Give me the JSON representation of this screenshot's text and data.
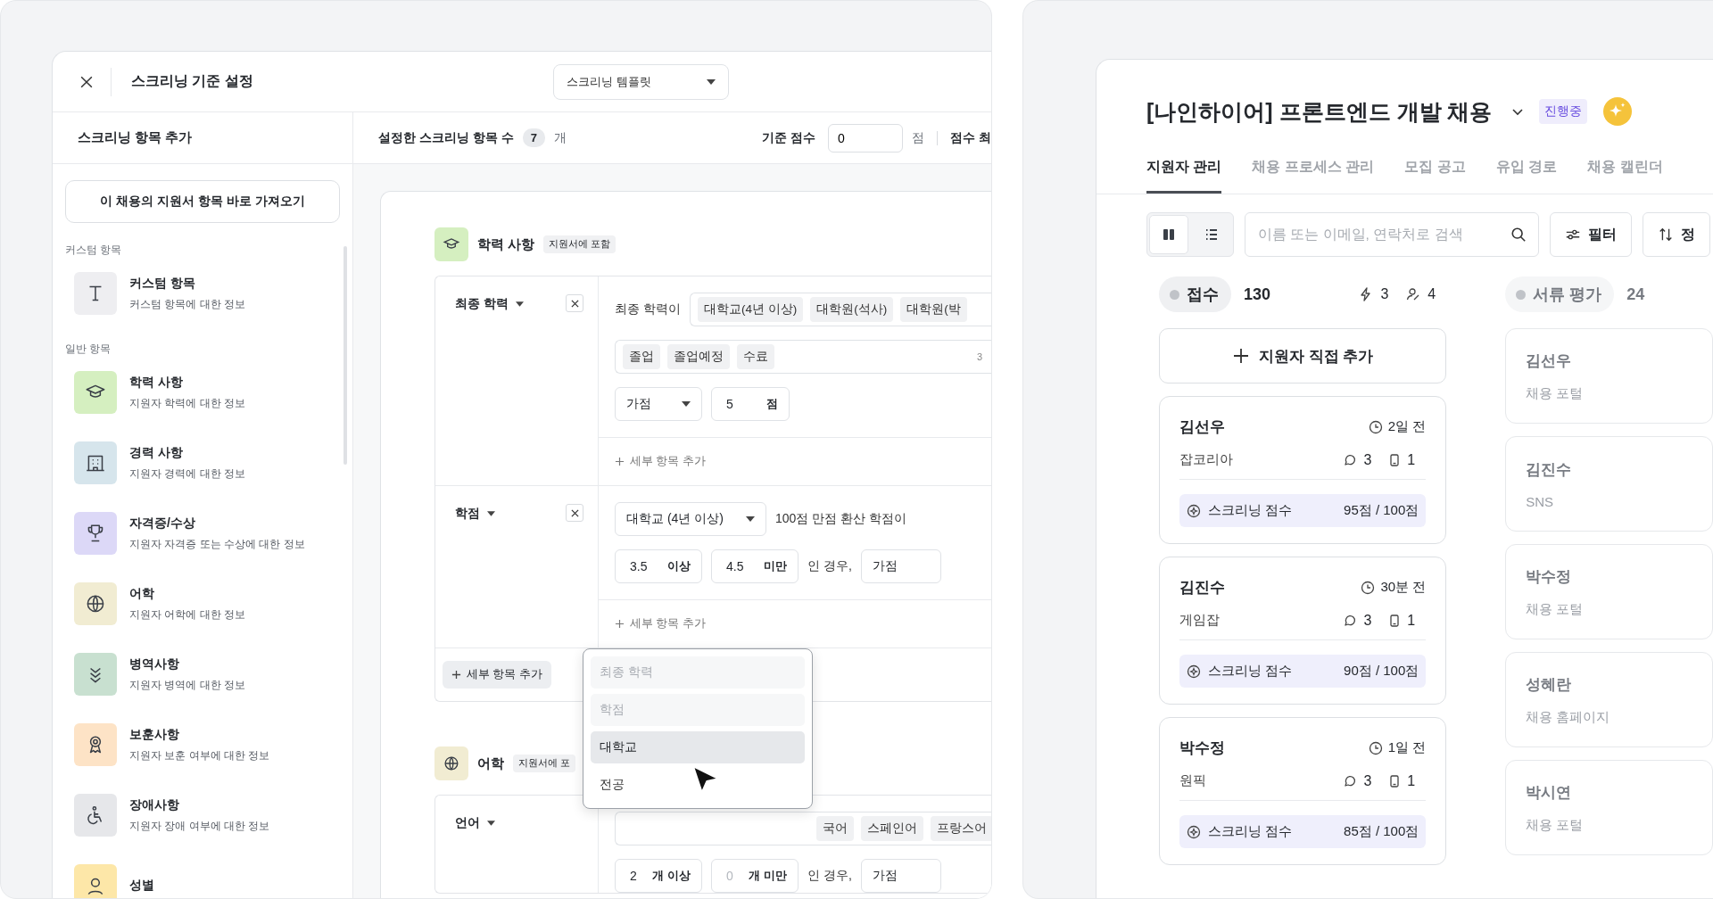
{
  "screening_window": {
    "title": "스크리닝 기준 설정",
    "template_select": {
      "value": "스크리닝 템플릿"
    },
    "sidebar": {
      "heading": "스크리닝 항목 추가",
      "import_button": "이 채용의 지원서 항목 바로 가져오기",
      "groups": [
        {
          "label": "커스텀 항목",
          "items": [
            {
              "title": "커스텀 항목",
              "description": "커스텀 항목에 대한 정보",
              "color": "#eeeef1"
            }
          ]
        },
        {
          "label": "일반 항목",
          "items": [
            {
              "title": "학력 사항",
              "description": "지원자 학력에 대한 정보",
              "color": "#d5efc0"
            },
            {
              "title": "경력 사항",
              "description": "지원자 경력에 대한 정보",
              "color": "#d6e5ec"
            },
            {
              "title": "자격증/수상",
              "description": "지원자 자격증 또는 수상에 대한 정보",
              "color": "#dcd8f7"
            },
            {
              "title": "어학",
              "description": "지원자 어학에 대한 정보",
              "color": "#f1ecd2"
            },
            {
              "title": "병역사항",
              "description": "지원자 병역에 대한 정보",
              "color": "#c8e0d0"
            },
            {
              "title": "보훈사항",
              "description": "지원자 보훈 여부에 대한 정보",
              "color": "#fde3c6"
            },
            {
              "title": "장애사항",
              "description": "지원자 장애 여부에 대한 정보",
              "color": "#e6e7ea"
            },
            {
              "title": "성별",
              "color": "#fde7a8"
            }
          ]
        }
      ]
    },
    "summary": {
      "label": "설정한 스크리닝 항목 수",
      "count": "7",
      "unit": "개",
      "base_score_label": "기준 점수",
      "base_score_value": "0",
      "base_score_unit": "점",
      "next_label": "점수 최"
    },
    "education": {
      "title": "학력 사항",
      "badge": "지원서에 포함",
      "color": "#d5efc0",
      "final_degree": {
        "label": "최종 학력",
        "prefix": "최종 학력이",
        "degrees": [
          "대학교(4년 이상)",
          "대학원(석사)",
          "대학원(박"
        ],
        "statuses": [
          "졸업",
          "졸업예정",
          "수료"
        ],
        "status_count": "3",
        "score_type": "가점",
        "score": "5",
        "score_unit": "점",
        "add_sub": "세부 항목 추가"
      },
      "gpa": {
        "label": "학점",
        "school": "대학교 (4년 이상)",
        "suffix": "100점 만점 환산 학점이",
        "min": "3.5",
        "min_unit": "이상",
        "max": "4.5",
        "max_unit": "미만",
        "condition": "인 경우,",
        "score_type": "가점",
        "add_sub": "세부 항목 추가"
      },
      "add_button": "세부 항목 추가",
      "menu": [
        {
          "label": "최종 학력",
          "disabled": true,
          "selected": false
        },
        {
          "label": "학점",
          "disabled": true,
          "selected": false
        },
        {
          "label": "대학교",
          "disabled": false,
          "selected": true
        },
        {
          "label": "전공",
          "disabled": false,
          "selected": false
        }
      ]
    },
    "language": {
      "title": "어학",
      "badge": "지원서에 포",
      "color": "#f1ecd2",
      "criterion": {
        "label": "언어",
        "languages": [
          "국어",
          "스페인어",
          "프랑스어"
        ],
        "min": "2",
        "min_unit": "개 이상",
        "max_placeholder": "0",
        "max_unit": "개 미만",
        "condition": "인 경우,",
        "score_type": "가점"
      }
    }
  },
  "hiring_window": {
    "title": "[나인하이어] 프론트엔드 개발 채용",
    "status": "진행중",
    "tabs": [
      {
        "label": "지원자 관리",
        "selected": true
      },
      {
        "label": "채용 프로세스 관리",
        "selected": false
      },
      {
        "label": "모집 공고",
        "selected": false
      },
      {
        "label": "유입 경로",
        "selected": false
      },
      {
        "label": "채용 캘린더",
        "selected": false
      }
    ],
    "view_modes": [
      {
        "selected": true
      },
      {
        "selected": false
      }
    ],
    "search": {
      "placeholder": "이름 또는 이메일, 연락처로 검색"
    },
    "filter_button": "필터",
    "sort_button": "정",
    "columns": [
      {
        "name": "접수",
        "count": "130",
        "bolt_count": "3",
        "assignee_count": "4",
        "add_button": "지원자 직접 추가",
        "cards": [
          {
            "kind": "full",
            "name": "김선우",
            "time": "2일 전",
            "source": "잡코리아",
            "comments": "3",
            "files": "1",
            "score_label": "스크리닝 점수",
            "score": "95점 / 100점"
          },
          {
            "kind": "full",
            "name": "김진수",
            "time": "30분 전",
            "source": "게임잡",
            "comments": "3",
            "files": "1",
            "score_label": "스크리닝 점수",
            "score": "90점 / 100점"
          },
          {
            "kind": "full",
            "name": "박수정",
            "time": "1일 전",
            "source": "원픽",
            "comments": "3",
            "files": "1",
            "score_label": "스크리닝 점수",
            "score": "85점 / 100점"
          }
        ]
      },
      {
        "name": "서류 평가",
        "count": "24",
        "cards": [
          {
            "kind": "brief",
            "name": "김선우",
            "source": "채용 포털"
          },
          {
            "kind": "brief",
            "name": "김진수",
            "source": "SNS"
          },
          {
            "kind": "brief",
            "name": "박수정",
            "source": "채용 포털"
          },
          {
            "kind": "brief",
            "name": "성혜란",
            "source": "채용 홈페이지"
          },
          {
            "kind": "brief",
            "name": "박시연",
            "source": "채용 포털"
          }
        ]
      }
    ]
  }
}
